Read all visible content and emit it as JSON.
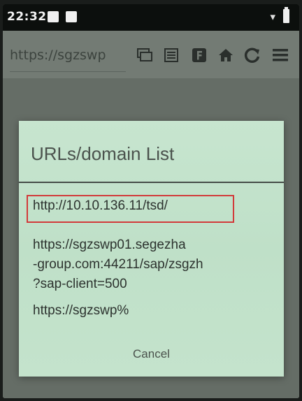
{
  "status_bar": {
    "time": "22:32"
  },
  "toolbar": {
    "url": "https://sgzswp",
    "icons": [
      "tabs-icon",
      "list-icon",
      "bookmark-f-icon",
      "home-icon",
      "reload-icon",
      "menu-icon"
    ]
  },
  "dialog": {
    "title": "URLs/domain List",
    "items": [
      {
        "label": "http://10.10.136.11/tsd/"
      },
      {
        "label": "https://sgzswp01.segezha-group.com:44211/sap/zsgzh?sap-client=500",
        "lines": [
          "https://sgzswp01.segezha",
          "-group.com:44211/sap/zsgzh",
          "?sap-client=500"
        ]
      },
      {
        "label": "https://sgzswp%"
      }
    ],
    "cancel_label": "Cancel"
  },
  "colors": {
    "dialog_bg": "#c4e3cc",
    "highlight": "#d23a3a"
  }
}
